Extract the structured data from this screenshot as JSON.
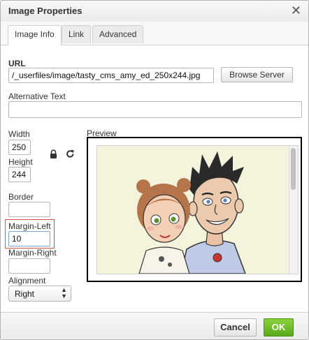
{
  "dialog": {
    "title": "Image Properties",
    "close_icon": "close-icon"
  },
  "tabs": [
    {
      "label": "Image Info",
      "active": true
    },
    {
      "label": "Link",
      "active": false
    },
    {
      "label": "Advanced",
      "active": false
    }
  ],
  "url": {
    "label": "URL",
    "value": "/_userfiles/image/tasty_cms_amy_ed_250x244.jpg",
    "browse_label": "Browse Server"
  },
  "alt": {
    "label": "Alternative Text",
    "value": ""
  },
  "width": {
    "label": "Width",
    "value": "250"
  },
  "height": {
    "label": "Height",
    "value": "244"
  },
  "lock_icon": "lock-icon",
  "reset_icon": "reset-size-icon",
  "border": {
    "label": "Border",
    "value": ""
  },
  "margin_left": {
    "label": "Margin-Left",
    "value": "10"
  },
  "margin_right": {
    "label": "Margin-Right",
    "value": ""
  },
  "alignment": {
    "label": "Alignment",
    "selected": "Right"
  },
  "preview": {
    "label": "Preview"
  },
  "footer": {
    "cancel_label": "Cancel",
    "ok_label": "OK"
  },
  "colors": {
    "ok_green": "#6dbf29",
    "highlight_red": "#d6553d",
    "preview_bg": "#f4f3dc"
  }
}
